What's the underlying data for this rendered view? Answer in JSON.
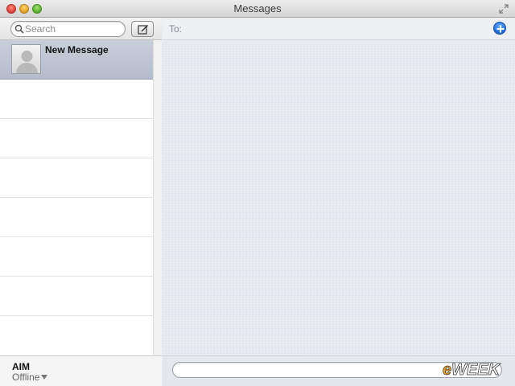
{
  "window": {
    "title": "Messages"
  },
  "sidebar": {
    "search": {
      "placeholder": "Search",
      "value": ""
    },
    "conversations": [
      {
        "name": "New Message",
        "selected": true
      }
    ],
    "account": {
      "name": "AIM",
      "status": "Offline"
    }
  },
  "main": {
    "to_label": "To:",
    "to_value": "",
    "message_value": ""
  },
  "watermark": {
    "text": "eWEEK"
  },
  "colors": {
    "selection": "#b4bccb",
    "accent": "#1d6fe0",
    "pane_bg": "#e6e9ef"
  },
  "icons": [
    "close-icon",
    "minimize-icon",
    "zoom-icon",
    "fullscreen-icon",
    "search-icon",
    "compose-icon",
    "avatar-placeholder-icon",
    "chevron-down-icon",
    "add-contact-icon"
  ]
}
